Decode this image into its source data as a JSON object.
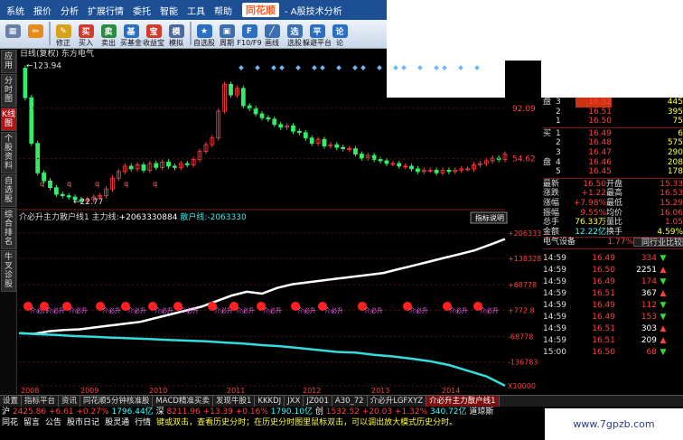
{
  "menu": {
    "items": [
      "系统",
      "报价",
      "分析",
      "扩展行情",
      "委托",
      "智能",
      "工具",
      "帮助"
    ],
    "logo": "同花顺",
    "app_title": "- A股技术分析"
  },
  "toolbar": {
    "buttons": [
      {
        "label": "",
        "icon": "grid-icon",
        "color": "#6a7fa8"
      },
      {
        "label": "",
        "icon": "back-arrow-icon",
        "color": "#e58c1a"
      },
      {
        "label": "修正",
        "icon": "pencil-icon",
        "color": "#d9a01a"
      },
      {
        "label": "买入",
        "icon": "buy-icon",
        "color": "#d23b2b"
      },
      {
        "label": "卖出",
        "icon": "sell-icon",
        "color": "#2b8a3e"
      },
      {
        "label": "买基金",
        "icon": "fund-icon",
        "color": "#2b6fc2"
      },
      {
        "label": "收益宝",
        "icon": "treasure-icon",
        "color": "#d23b2b"
      },
      {
        "label": "模拟",
        "icon": "simulate-icon",
        "color": "#4a6aa0"
      },
      {
        "label": "自选股",
        "icon": "star-icon",
        "color": "#2b6fc2"
      },
      {
        "label": "周期",
        "icon": "calendar-icon",
        "color": "#3a6fb0"
      },
      {
        "label": "F10/F9",
        "icon": "f10-icon",
        "color": "#2b6fc2"
      },
      {
        "label": "画线",
        "icon": "draw-line-icon",
        "color": "#3a6fb0"
      },
      {
        "label": "选股",
        "icon": "filter-icon",
        "color": "#3a6fb0"
      },
      {
        "label": "躲避平台",
        "icon": "platform-icon",
        "color": "#2b6fc2"
      },
      {
        "label": "论",
        "icon": "forum-icon",
        "color": "#2b6fc2"
      }
    ],
    "icon_glyphs": [
      "▦",
      "⇦",
      "✎",
      "买",
      "卖",
      "基",
      "宝",
      "模",
      "★",
      "▣",
      "F",
      "╱",
      "选",
      "平",
      "论"
    ]
  },
  "sidebar": {
    "tabs": [
      "应用",
      "分时图",
      "K线图",
      "个股资料",
      "自选股",
      "综合排名",
      "牛叉诊股"
    ],
    "active": 2
  },
  "kline_header": "日线(复权) 东方电气",
  "chart_data": {
    "type": "line",
    "title": "日线(复权) 东方电气",
    "top_panel": {
      "yticks": [
        "92.09",
        "54.62"
      ],
      "high_label": "123.94",
      "low_label": "22.77",
      "price_series": [
        122,
        100,
        66,
        44,
        38,
        33,
        28,
        27,
        26,
        24,
        23,
        24,
        26,
        27,
        32,
        40,
        45,
        49,
        47,
        50,
        46,
        51,
        48,
        52,
        49,
        48,
        51,
        50,
        54,
        60,
        65,
        70,
        90,
        110,
        102,
        107,
        94,
        92,
        88,
        85,
        84,
        80,
        78,
        79,
        75,
        74,
        70,
        66,
        69,
        64,
        65,
        63,
        62,
        62,
        58,
        55,
        57,
        54,
        53,
        51,
        51,
        49,
        49,
        47,
        45,
        46,
        46,
        44,
        46,
        45,
        46,
        47,
        47,
        50,
        51,
        53,
        55,
        54,
        58
      ]
    },
    "indicator": {
      "name": "介必升主力散户线1",
      "main_label": "主力线:",
      "main_value": "+2063330884",
      "retail_label": "散户线:",
      "retail_value": "-2063330",
      "explain_button": "指标说明",
      "yticks": [
        "+206333",
        "+138328",
        "+68778",
        "+772.8",
        "-68778",
        "-136783",
        "X10000"
      ],
      "main_series": [
        -60,
        -62,
        -55,
        -52,
        -50,
        -45,
        -40,
        -35,
        -30,
        -20,
        -10,
        0,
        10,
        25,
        40,
        50,
        45,
        60,
        70,
        75,
        80,
        85,
        90,
        95,
        100,
        110,
        120,
        130,
        140,
        150,
        160,
        175,
        190
      ],
      "retail_series": [
        -60,
        -63,
        -65,
        -68,
        -70,
        -72,
        -74,
        -76,
        -78,
        -80,
        -82,
        -85,
        -88,
        -92,
        -95,
        -100,
        -105,
        -110,
        -112,
        -118,
        -122,
        -128,
        -135,
        -145,
        -160,
        -175,
        -200
      ],
      "signal_label": "介必升",
      "signals": [
        "2008",
        "2008",
        "2008",
        "2009",
        "2009",
        "2009",
        "2009",
        "2010",
        "2010",
        "2010",
        "2011",
        "2011",
        "2012",
        "2012",
        "2013",
        "2013",
        "2014"
      ]
    },
    "xticks": [
      "2008",
      "2009",
      "2010",
      "2011",
      "2012",
      "2013",
      "2014"
    ]
  },
  "quote": {
    "sell_rows": [
      {
        "side": "盘",
        "lvl": "3",
        "price": "16.52",
        "vol": "445"
      },
      {
        "side": "",
        "lvl": "2",
        "price": "16.51",
        "vol": "395"
      },
      {
        "side": "",
        "lvl": "1",
        "price": "16.50",
        "vol": "75"
      }
    ],
    "buy_rows": [
      {
        "side": "买",
        "lvl": "1",
        "price": "16.49",
        "vol": "6"
      },
      {
        "side": "",
        "lvl": "2",
        "price": "16.48",
        "vol": "575"
      },
      {
        "side": "",
        "lvl": "3",
        "price": "16.47",
        "vol": "290"
      },
      {
        "side": "盘",
        "lvl": "4",
        "price": "16.46",
        "vol": "208"
      },
      {
        "side": "",
        "lvl": "5",
        "price": "16.45",
        "vol": "178"
      }
    ],
    "stats": [
      [
        "最新",
        "16.50",
        "开盘",
        "15.33"
      ],
      [
        "涨跌",
        "+1.22",
        "最高",
        "16.53"
      ],
      [
        "涨幅",
        "+7.98%",
        "最低",
        "15.29"
      ],
      [
        "振幅",
        "9.55%",
        "均价",
        "16.06"
      ],
      [
        "总手",
        "76.33万",
        "量比",
        "1.05"
      ],
      [
        "金额",
        "12.22亿",
        "换手",
        "4.59%"
      ]
    ],
    "sector": "电气设备",
    "sector_change": "1.77%",
    "compare_button": "同行业比较",
    "ticks": [
      {
        "time": "14:59",
        "price": "16.49",
        "vol": "334",
        "dir": "down",
        "pc": "up"
      },
      {
        "time": "14:59",
        "price": "16.50",
        "vol": "2251",
        "dir": "up",
        "pc": "up"
      },
      {
        "time": "14:59",
        "price": "16.49",
        "vol": "174",
        "dir": "down",
        "pc": "up"
      },
      {
        "time": "14:59",
        "price": "16.51",
        "vol": "367",
        "dir": "up",
        "pc": "up"
      },
      {
        "time": "14:59",
        "price": "16.49",
        "vol": "112",
        "dir": "down",
        "pc": "up"
      },
      {
        "time": "14:59",
        "price": "16.49",
        "vol": "153",
        "dir": "down",
        "pc": "up"
      },
      {
        "time": "14:59",
        "price": "16.51",
        "vol": "303",
        "dir": "up",
        "pc": "up"
      },
      {
        "time": "14:59",
        "price": "16.51",
        "vol": "209",
        "dir": "up",
        "pc": "up"
      },
      {
        "time": "15:00",
        "price": "16.50",
        "vol": "68",
        "dir": "down",
        "pc": "up"
      }
    ]
  },
  "bottom_tabs": [
    "设置",
    "指标平台",
    "资讯",
    "同花顺5分钟核准股",
    "MACD精准买卖",
    "发现牛股1",
    "KKKDJ",
    "JXX",
    "JZ001",
    "A30_72",
    "介必升LGFXYZ",
    "介必升主力散户线1"
  ],
  "bottom_active": 11,
  "status": {
    "sh_label": "沪",
    "sh_index": "2425.86",
    "sh_chg": "+6.61",
    "sh_pct": "+0.27%",
    "sh_amt": "1796.44亿",
    "sz_label": "深",
    "sz_index": "8211.96",
    "sz_chg": "+13.39",
    "sz_pct": "+0.16%",
    "sz_amt": "1790.10亿",
    "cy_label": "创",
    "cy_index": "1532.52",
    "cy_chg": "+20.03",
    "cy_pct": "+1.32%",
    "cy_amt": "340.72亿",
    "dji": "道琼斯"
  },
  "footer": {
    "links": [
      "同花",
      "留言",
      "公告",
      "股市日记",
      "股灵通",
      "行情"
    ],
    "tip": "键或双击，查看历史分时；在历史分时图里鼠标双击，可以调出放大模式历史分时。"
  },
  "watermark": "www.7gpzb.com"
}
